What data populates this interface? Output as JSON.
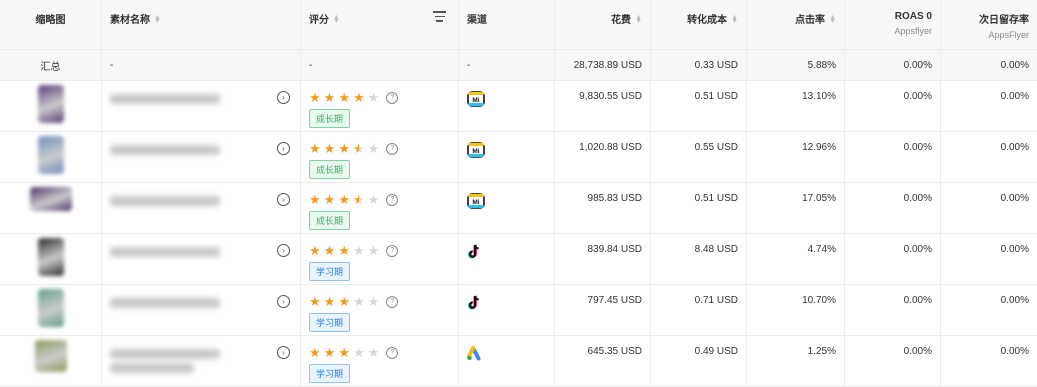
{
  "columns": {
    "thumb": "缩略图",
    "name": "素材名称",
    "rating": "评分",
    "channel": "渠道",
    "spend": "花费",
    "conv_cost": "转化成本",
    "ctr": "点击率",
    "roas": "ROAS 0",
    "roas_sub": "Appsflyer",
    "retention": "次日留存率",
    "retention_sub": "AppsFlyer"
  },
  "summary": {
    "label": "汇总",
    "name": "-",
    "rating": "-",
    "channel": "-",
    "spend": "28,738.89 USD",
    "conv_cost": "0.33 USD",
    "ctr": "5.88%",
    "roas": "0.00%",
    "retention": "0.00%"
  },
  "rows": [
    {
      "thumb_color": "#5a3a7a",
      "thumb_shape": "tall",
      "stars": 4.0,
      "stage": "成长期",
      "stage_type": "grow",
      "channel": "mintegral",
      "channel_icon": "mintegral-icon",
      "spend": "9,830.55 USD",
      "conv_cost": "0.51 USD",
      "ctr": "13.10%",
      "roas": "0.00%",
      "retention": "0.00%"
    },
    {
      "thumb_color": "#6f8fbf",
      "thumb_shape": "tall",
      "stars": 3.5,
      "stage": "成长期",
      "stage_type": "grow",
      "channel": "mintegral",
      "channel_icon": "mintegral-icon",
      "spend": "1,020.88 USD",
      "conv_cost": "0.55 USD",
      "ctr": "12.96%",
      "roas": "0.00%",
      "retention": "0.00%"
    },
    {
      "thumb_color": "#4a2e66",
      "thumb_shape": "wide",
      "stars": 3.5,
      "stage": "成长期",
      "stage_type": "grow",
      "channel": "mintegral",
      "channel_icon": "mintegral-icon",
      "spend": "985.83 USD",
      "conv_cost": "0.51 USD",
      "ctr": "17.05%",
      "roas": "0.00%",
      "retention": "0.00%"
    },
    {
      "thumb_color": "#2a2a2a",
      "thumb_shape": "tall",
      "stars": 3.0,
      "stage": "学习期",
      "stage_type": "learn",
      "channel": "tiktok",
      "channel_icon": "tiktok-icon",
      "spend": "839.84 USD",
      "conv_cost": "8.48 USD",
      "ctr": "4.74%",
      "roas": "0.00%",
      "retention": "0.00%"
    },
    {
      "thumb_color": "#5f9f8a",
      "thumb_shape": "tall",
      "stars": 3.0,
      "stage": "学习期",
      "stage_type": "learn",
      "channel": "tiktok",
      "channel_icon": "tiktok-icon",
      "spend": "797.45 USD",
      "conv_cost": "0.71 USD",
      "ctr": "10.70%",
      "roas": "0.00%",
      "retention": "0.00%"
    },
    {
      "thumb_color": "#8a9a5a",
      "thumb_shape": "square",
      "stars": 3.0,
      "stage": "学习期",
      "stage_type": "learn",
      "channel": "google-ads",
      "channel_icon": "google-ads-icon",
      "spend": "645.35 USD",
      "conv_cost": "0.49 USD",
      "ctr": "1.25%",
      "roas": "0.00%",
      "retention": "0.00%"
    }
  ]
}
